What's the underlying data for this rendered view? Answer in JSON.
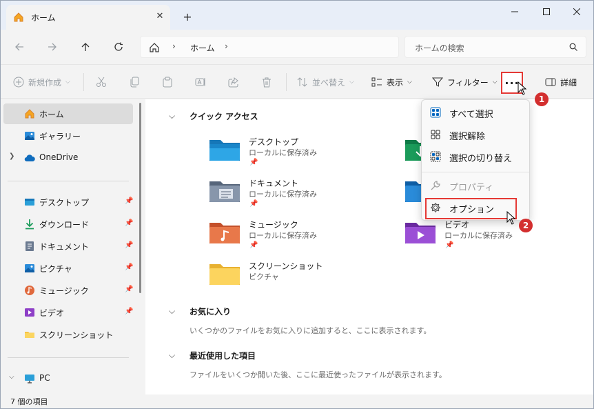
{
  "tab": {
    "title": "ホーム",
    "close": "✕",
    "new_tab": "+"
  },
  "address": {
    "location": "ホーム",
    "sep": "›"
  },
  "search": {
    "placeholder": "ホームの検索"
  },
  "toolbar": {
    "new": "新規作成",
    "sort": "並べ替え",
    "view": "表示",
    "filter": "フィルター",
    "more": "···",
    "details": "詳細"
  },
  "sidebar": {
    "items": [
      {
        "label": "ホーム",
        "icon": "home-icon"
      },
      {
        "label": "ギャラリー",
        "icon": "gallery-icon"
      },
      {
        "label": "OneDrive",
        "icon": "cloud-icon"
      },
      {
        "label": "デスクトップ",
        "icon": "desktop-icon"
      },
      {
        "label": "ダウンロード",
        "icon": "download-icon"
      },
      {
        "label": "ドキュメント",
        "icon": "document-icon"
      },
      {
        "label": "ピクチャ",
        "icon": "pictures-icon"
      },
      {
        "label": "ミュージック",
        "icon": "music-icon"
      },
      {
        "label": "ビデオ",
        "icon": "video-icon"
      },
      {
        "label": "スクリーンショット",
        "icon": "folder-icon"
      },
      {
        "label": "PC",
        "icon": "pc-icon"
      }
    ]
  },
  "quick_access": {
    "header": "クイック アクセス",
    "folders": [
      {
        "name": "デスクトップ",
        "sub": "ローカルに保存済み"
      },
      {
        "name": "ドキュメント",
        "sub": "ローカルに保存済み"
      },
      {
        "name": "ミュージック",
        "sub": "ローカルに保存済み"
      },
      {
        "name": "スクリーンショット",
        "sub": "ピクチャ"
      },
      {
        "name": "ビデオ",
        "sub": "ローカルに保存済み"
      }
    ]
  },
  "favorites": {
    "header": "お気に入り",
    "empty": "いくつかのファイルをお気に入りに追加すると、ここに表示されます。"
  },
  "recent": {
    "header": "最近使用した項目",
    "empty": "ファイルをいくつか開いた後、ここに最近使ったファイルが表示されます。"
  },
  "status": {
    "count": "7 個の項目"
  },
  "menu": {
    "items": [
      {
        "label": "すべて選択"
      },
      {
        "label": "選択解除"
      },
      {
        "label": "選択の切り替え"
      },
      {
        "label": "プロパティ"
      },
      {
        "label": "オプション"
      }
    ]
  },
  "badges": {
    "one": "1",
    "two": "2"
  },
  "colors": {
    "highlight": "#e53935",
    "badge": "#d32f2f",
    "accent": "#0067c0"
  }
}
